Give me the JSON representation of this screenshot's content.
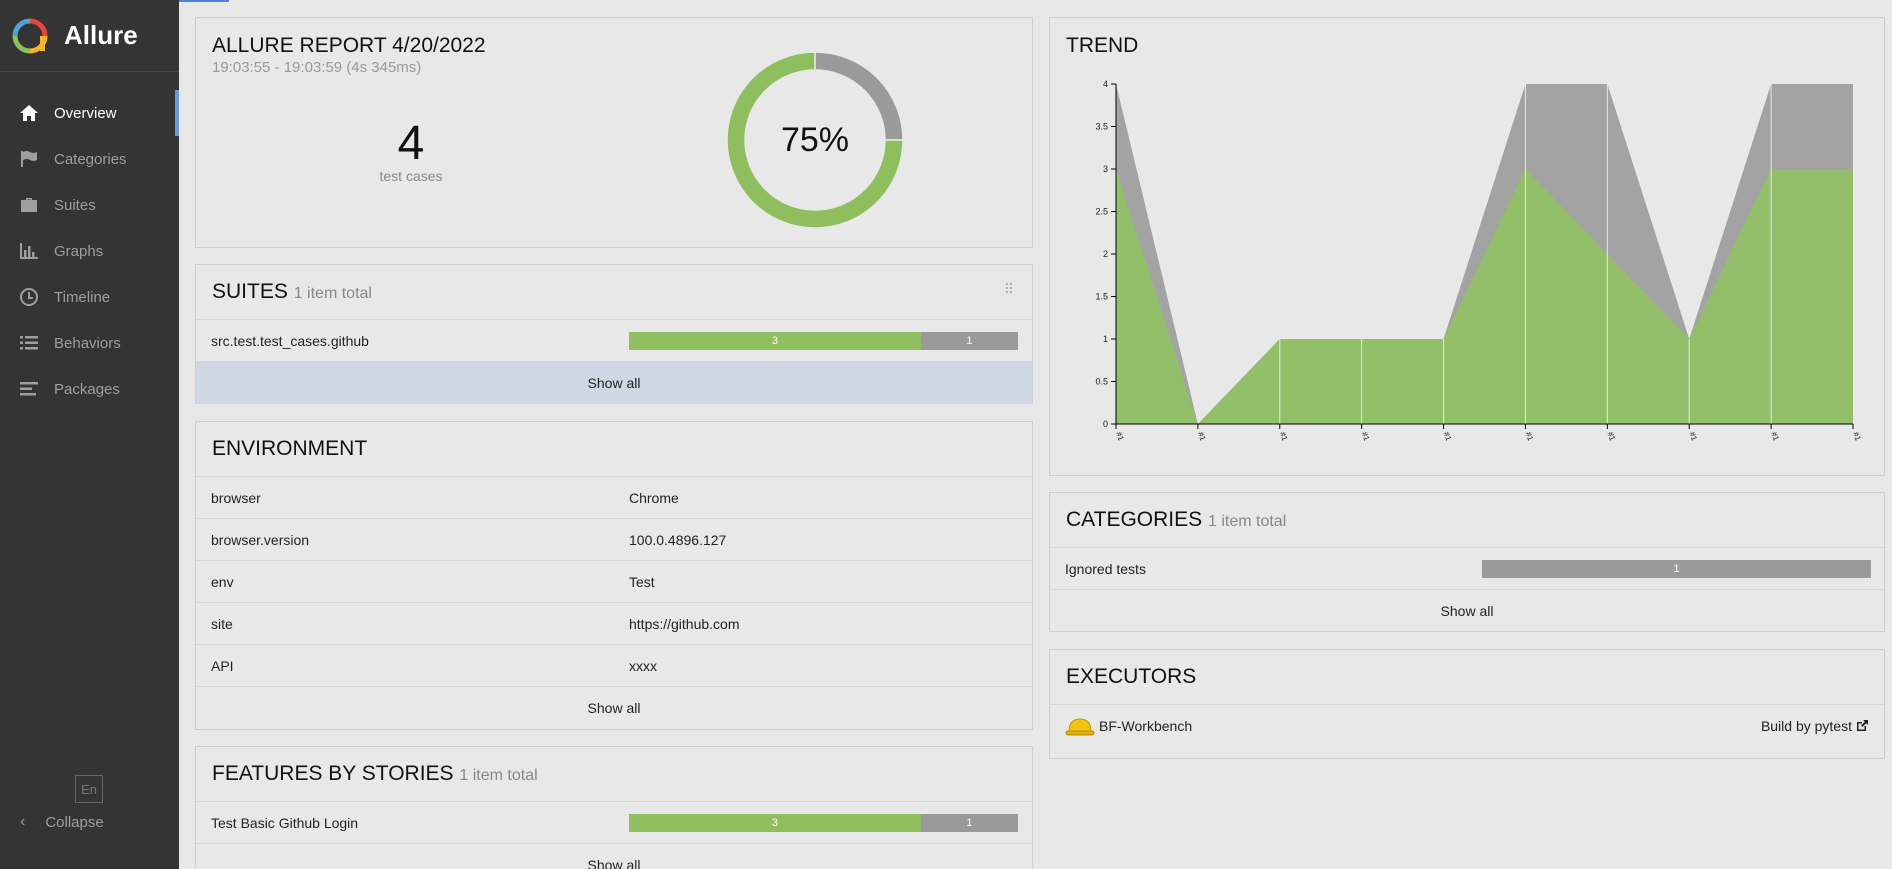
{
  "app": {
    "name": "Allure"
  },
  "sidebar": {
    "items": [
      {
        "label": "Overview",
        "icon": "home-icon",
        "active": true
      },
      {
        "label": "Categories",
        "icon": "flag-icon"
      },
      {
        "label": "Suites",
        "icon": "briefcase-icon"
      },
      {
        "label": "Graphs",
        "icon": "bar-chart-icon"
      },
      {
        "label": "Timeline",
        "icon": "clock-icon"
      },
      {
        "label": "Behaviors",
        "icon": "list-icon"
      },
      {
        "label": "Packages",
        "icon": "align-left-icon"
      }
    ],
    "lang": "En",
    "collapse": "Collapse"
  },
  "summary": {
    "title": "ALLURE REPORT 4/20/2022",
    "time": "19:03:55 - 19:03:59 (4s 345ms)",
    "count": "4",
    "count_label": "test cases",
    "percent": "75%",
    "pass_fraction": 0.75,
    "colors": {
      "passed": "#8fbe5e",
      "skipped": "#9a9a9a"
    }
  },
  "suites": {
    "title": "SUITES",
    "count": "1 item total",
    "rows": [
      {
        "name": "src.test.test_cases.github",
        "passed": "3",
        "skipped": "1",
        "pass_fraction": 0.75
      }
    ],
    "show_all": "Show all"
  },
  "environment": {
    "title": "ENVIRONMENT",
    "rows": [
      {
        "key": "browser",
        "value": "Chrome"
      },
      {
        "key": "browser.version",
        "value": "100.0.4896.127"
      },
      {
        "key": "env",
        "value": "Test"
      },
      {
        "key": "site",
        "value": "https://github.com"
      },
      {
        "key": "API",
        "value": "xxxx"
      }
    ],
    "show_all": "Show all"
  },
  "features": {
    "title": "FEATURES BY STORIES",
    "count": "1 item total",
    "rows": [
      {
        "name": "Test Basic Github Login",
        "passed": "3",
        "skipped": "1",
        "pass_fraction": 0.75
      }
    ],
    "show_all": "Show all"
  },
  "trend": {
    "title": "TREND"
  },
  "chart_data": {
    "type": "area",
    "title": "TREND",
    "categories": [
      "#1",
      "#1",
      "#1",
      "#1",
      "#1",
      "#1",
      "#1",
      "#1",
      "#1",
      "#1"
    ],
    "series": [
      {
        "values": [
          3,
          0,
          1,
          1,
          1,
          3,
          2,
          1,
          3,
          3
        ]
      },
      {
        "values": [
          1,
          0,
          0,
          0,
          0,
          1,
          2,
          0,
          1,
          1
        ]
      }
    ],
    "yticks": [
      "0",
      "0.5",
      "1",
      "1.5",
      "2",
      "2.5",
      "3",
      "3.5",
      "4"
    ],
    "ylim": [
      0,
      4
    ],
    "colors": [
      "#93bf6b",
      "#a3a3a3"
    ]
  },
  "categories": {
    "title": "CATEGORIES",
    "count": "1 item total",
    "rows": [
      {
        "name": "Ignored tests",
        "value": "1"
      }
    ],
    "show_all": "Show all"
  },
  "executors": {
    "title": "EXECUTORS",
    "name": "BF-Workbench",
    "build": "Build by pytest"
  }
}
